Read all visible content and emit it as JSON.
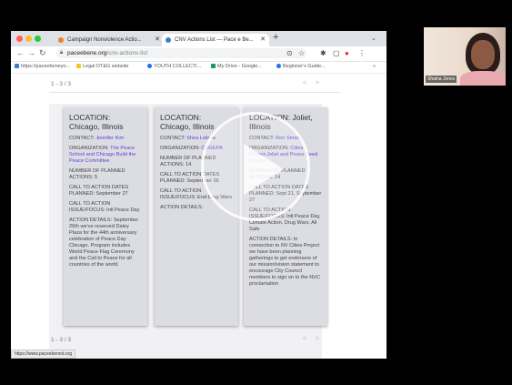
{
  "browser": {
    "tabs": [
      {
        "label": "Campaign Nonviolence Actio...",
        "active": false
      },
      {
        "label": "CNV Actions List — Pace e Be...",
        "active": true
      }
    ],
    "url_host": "paceebene.org",
    "url_path": "/cnv-actions-list",
    "bookmarks": [
      "https://paceebeneyo...",
      "Legal DT&G website",
      "YOUTH COLLECTI...",
      "My Drive - Google...",
      "Beginner's Guide..."
    ]
  },
  "page": {
    "pager_top": "1 - 3 / 3",
    "pager_bottom": "1 - 3 / 3",
    "cards": [
      {
        "location": "LOCATION: Chicago, Illinois",
        "contact_label": "CONTACT:",
        "contact_name": "Jennifer Kim",
        "org_label": "ORGANIZATION:",
        "org_name": "The Peace School and Chicago Build the Peace Committee",
        "planned": "NUMBER OF PLANNED ACTIONS: 5",
        "dates": "CALL TO ACTION DATES PLANNED: September 27",
        "issue": "CALL TO ACTION ISSUE/FOCUS: Intl Peace Day",
        "details": "ACTION DETAILS: September 26th we've reserved Daley Plaza for the 44th anniversary celebration of Peace Day Chicago. Program includes World Peace Flag Ceremony and the Call to Peace for all countries of the world."
      },
      {
        "location": "LOCATION: Chicago, Illinois",
        "contact_label": "CONTACT:",
        "contact_name": "Shea Leibow",
        "org_label": "ORGANIZATION:",
        "org_name": "COGEPA",
        "planned": "NUMBER OF PLANNED ACTIONS: 14",
        "dates": "CALL TO ACTION DATES PLANNED: September 26",
        "issue": "CALL TO ACTION ISSUE/FOCUS: End Drug Wars",
        "details": "ACTION DETAILS:"
      },
      {
        "location": "LOCATION: Joliet, Illinois",
        "contact_label": "CONTACT:",
        "contact_name": "Ron Smart",
        "org_label": "ORGANIZATION:",
        "org_name": "Cities Project-Joliet and Peace Seed Planters",
        "planned": "NUMBER OF PLANNED ACTIONS: 14",
        "dates": "CALL TO ACTION DATES PLANNED: Sept 21, September 27",
        "issue": "CALL TO ACTION ISSUE/FOCUS: Intl Peace Day, Climate Action, Drug Wars, All Safe",
        "details": "ACTION DETAILS: In connection to NV Cities Project we have been planning gatherings to get endorsers of our mission/vision statement to encourage City Council members to sign on to the NVC proclamation"
      }
    ],
    "status_url": "https://www.paceebened.org"
  },
  "camera": {
    "name": "Shaina Jones"
  },
  "colors": {
    "link": "#5d3fd3",
    "card_bg": "#dcdde3",
    "tab_strip": "#dee1e6"
  }
}
